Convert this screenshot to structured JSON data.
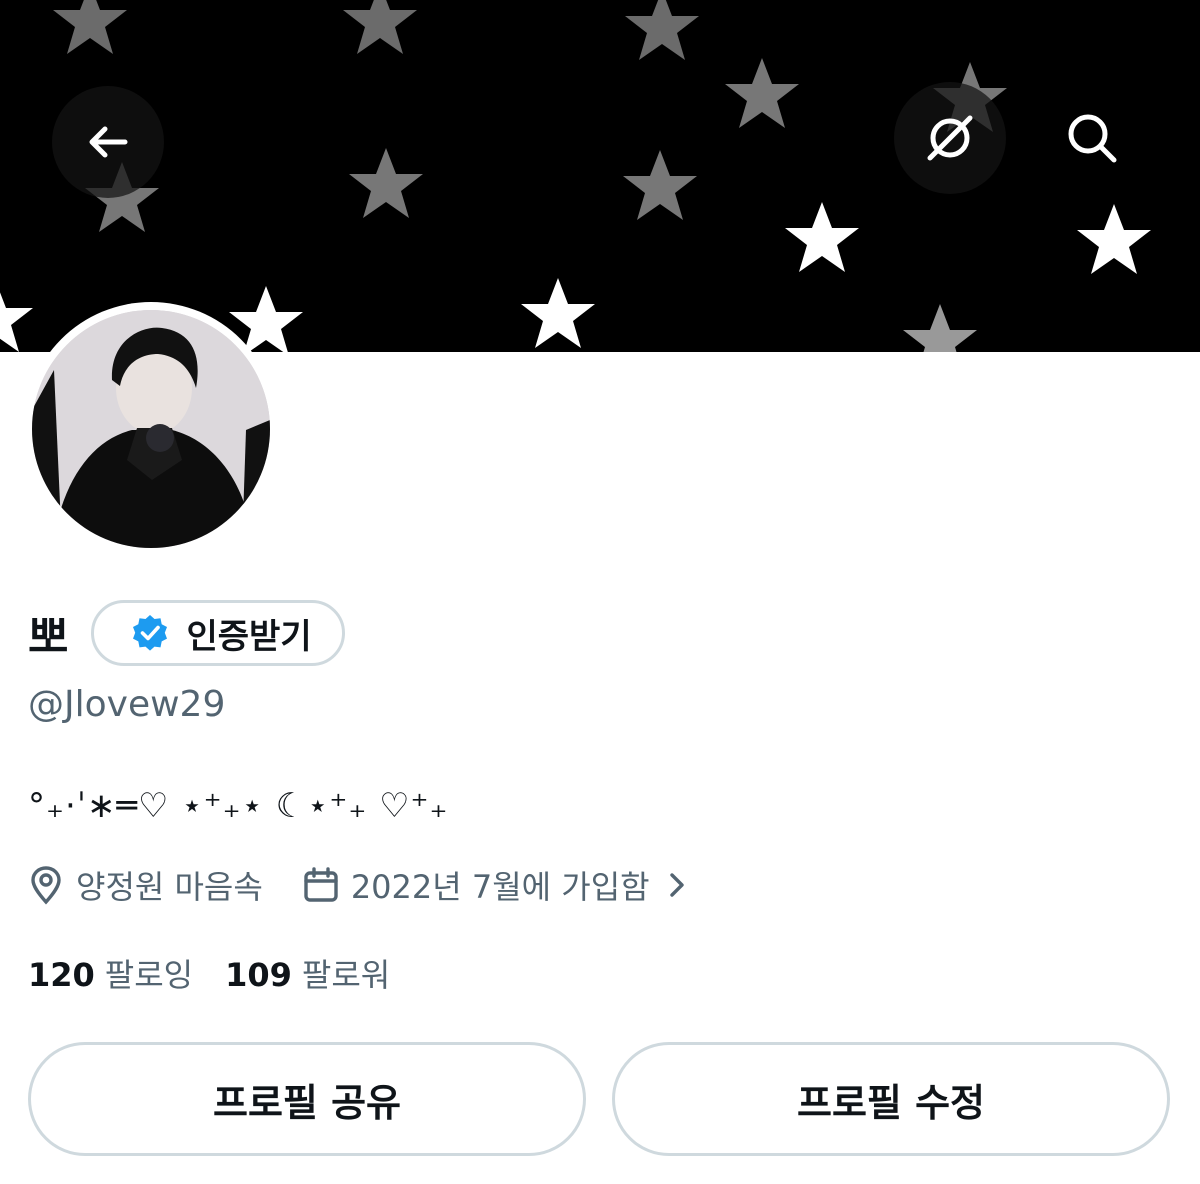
{
  "header": {
    "back_icon": "arrow-left-icon",
    "translate_icon": "translate-icon",
    "search_icon": "search-icon"
  },
  "profile": {
    "display_name": "뽀",
    "verify_label": "인증받기",
    "verify_badge_color": "#1d9bf0",
    "handle": "@Jlovew29",
    "bio": "°₊·ˈ∗═♡ ⋆⁺₊⋆ ☾⋆⁺₊ ♡⁺₊",
    "location": "양정원 마음속",
    "joined": "2022년 7월에 가입함"
  },
  "stats": {
    "following_count": "120",
    "following_label": "팔로잉",
    "followers_count": "109",
    "followers_label": "팔로워"
  },
  "actions": {
    "share_label": "프로필 공유",
    "edit_label": "프로필 수정"
  },
  "colors": {
    "text_primary": "#0f1419",
    "text_secondary": "#536471",
    "border": "#cfd9de",
    "banner": "#000000"
  }
}
